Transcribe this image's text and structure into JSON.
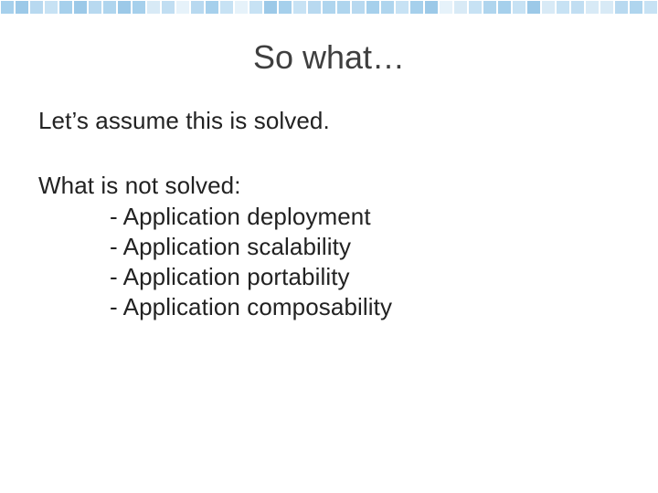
{
  "title": "So what…",
  "solved_line": "Let’s assume this is solved.",
  "not_solved_head": "What is not solved:",
  "items": {
    "i0": "- Application deployment",
    "i1": "- Application scalability",
    "i2": "- Application portability",
    "i3": "- Application composability"
  },
  "decor": {
    "palette": [
      "#b8d9f0",
      "#c7e2f4",
      "#d8eaf6",
      "#a6d0ec",
      "#9cc9e8",
      "#e6f2fa",
      "#c1def2",
      "#afd5ee"
    ]
  }
}
